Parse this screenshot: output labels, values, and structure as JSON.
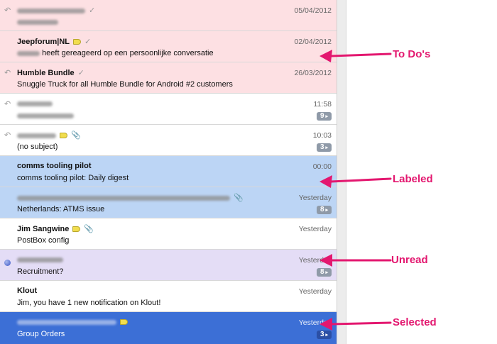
{
  "rows": [
    {
      "kind": "todo",
      "sender": "",
      "subject": "",
      "date": "05/04/2012",
      "count": ""
    },
    {
      "kind": "todo",
      "sender": "Jeepforum|NL",
      "subject": "heeft gereageerd op een persoonlijke conversatie",
      "date": "02/04/2012",
      "count": ""
    },
    {
      "kind": "todo",
      "sender": "Humble Bundle",
      "subject": "Snuggle Truck for all Humble Bundle for Android #2 customers",
      "date": "26/03/2012",
      "count": ""
    },
    {
      "kind": "plain",
      "sender": "",
      "subject": "",
      "date": "11:58",
      "count": "9"
    },
    {
      "kind": "plain",
      "sender": "",
      "subject": "(no subject)",
      "date": "10:03",
      "count": "3"
    },
    {
      "kind": "labeled",
      "sender": "comms tooling pilot",
      "subject": "comms tooling pilot: Daily digest",
      "date": "00:00",
      "count": ""
    },
    {
      "kind": "labeled",
      "sender": "",
      "subject": "Netherlands: ATMS issue",
      "date": "Yesterday",
      "count": "8"
    },
    {
      "kind": "plain",
      "sender": "Jim Sangwine",
      "subject": "PostBox config",
      "date": "Yesterday",
      "count": ""
    },
    {
      "kind": "unread",
      "sender": "",
      "subject": "Recruitment?",
      "date": "Yesterday",
      "count": "8"
    },
    {
      "kind": "plain",
      "sender": "Klout",
      "subject": "Jim, you have 1 new notification on Klout!",
      "date": "Yesterday",
      "count": ""
    },
    {
      "kind": "selected",
      "sender": "",
      "subject": "Group Orders",
      "date": "Yesterday",
      "count": "3"
    }
  ],
  "annotations": {
    "todo": "To Do's",
    "labeled": "Labeled",
    "unread": "Unread",
    "selected": "Selected"
  },
  "colors": {
    "todo_bg": "#fde0e3",
    "labeled_bg": "#bcd5f5",
    "unread_bg": "#e4ddf6",
    "selected_bg": "#3c6fd6",
    "callout": "#e3176f"
  }
}
